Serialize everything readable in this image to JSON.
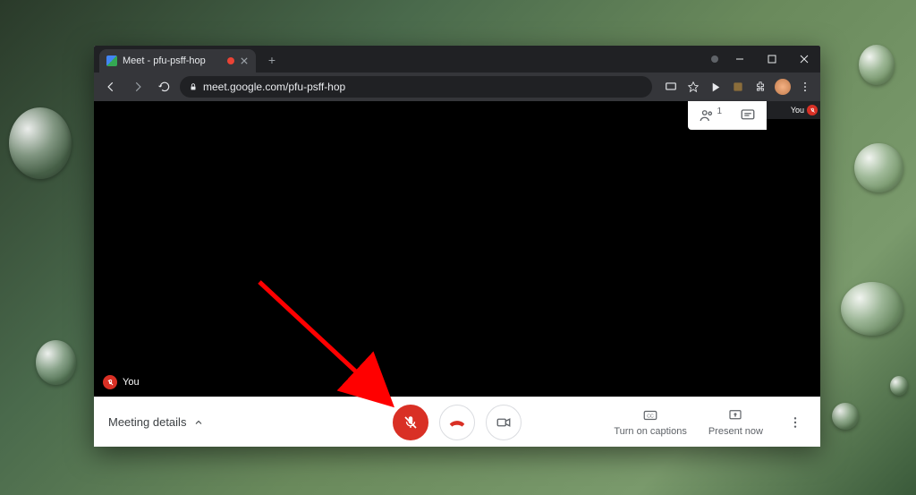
{
  "browser": {
    "tab_title": "Meet - pfu-psff-hop",
    "url_display": "meet.google.com/pfu-psff-hop"
  },
  "top_tools": {
    "participants_count": "1",
    "self_thumb_label": "You"
  },
  "self_label": "You",
  "bottombar": {
    "meeting_details": "Meeting details",
    "captions": "Turn on captions",
    "present": "Present now"
  },
  "colors": {
    "danger": "#d93025"
  }
}
